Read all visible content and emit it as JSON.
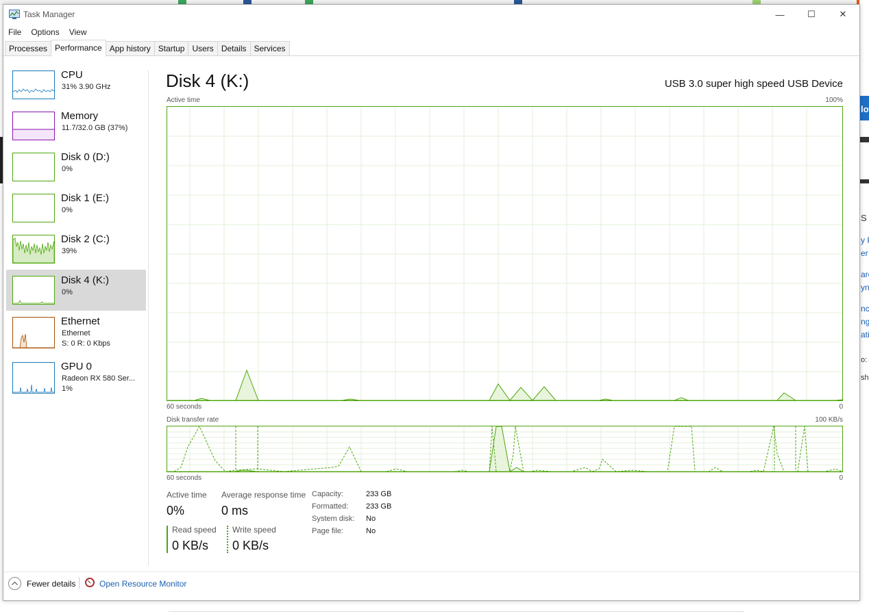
{
  "window": {
    "title": "Task Manager",
    "minimize": "—",
    "maximize": "☐",
    "close": "✕"
  },
  "menu": [
    "File",
    "Options",
    "View"
  ],
  "tabs": [
    "Processes",
    "Performance",
    "App history",
    "Startup",
    "Users",
    "Details",
    "Services"
  ],
  "active_tab": "Performance",
  "sidebar": [
    {
      "name": "CPU",
      "sub": "31%  3.90 GHz",
      "color": "#1779ba"
    },
    {
      "name": "Memory",
      "sub": "11.7/32.0 GB (37%)",
      "color": "#8b12ae"
    },
    {
      "name": "Disk 0 (D:)",
      "sub": "0%",
      "color": "#4da60c"
    },
    {
      "name": "Disk 1 (E:)",
      "sub": "0%",
      "color": "#4da60c"
    },
    {
      "name": "Disk 2 (C:)",
      "sub": "39%",
      "color": "#4da60c"
    },
    {
      "name": "Disk 4 (K:)",
      "sub": "0%",
      "color": "#4da60c"
    },
    {
      "name": "Ethernet",
      "sub": "Ethernet",
      "sub2": "S: 0  R: 0 Kbps",
      "color": "#a74f01"
    },
    {
      "name": "GPU 0",
      "sub": "Radeon RX 580 Ser...",
      "sub2": "1%",
      "color": "#1779ba"
    }
  ],
  "selected_item": "Disk 4 (K:)",
  "main": {
    "title": "Disk 4 (K:)",
    "device": "USB 3.0 super high speed USB Device",
    "graph1": {
      "label": "Active time",
      "max": "100%",
      "time": "60 seconds",
      "min": "0"
    },
    "graph2": {
      "label": "Disk transfer rate",
      "max": "100 KB/s",
      "time": "60 seconds",
      "min": "0"
    }
  },
  "stats": {
    "active_time_label": "Active time",
    "active_time": "0%",
    "avg_response_label": "Average response time",
    "avg_response": "0 ms",
    "read_label": "Read speed",
    "read": "0 KB/s",
    "write_label": "Write speed",
    "write": "0 KB/s"
  },
  "properties": [
    {
      "label": "Capacity:",
      "value": "233 GB"
    },
    {
      "label": "Formatted:",
      "value": "233 GB"
    },
    {
      "label": "System disk:",
      "value": "No"
    },
    {
      "label": "Page file:",
      "value": "No"
    }
  ],
  "footer": {
    "fewer": "Fewer details",
    "resmon": "Open Resource Monitor"
  },
  "colors": {
    "disk": "#4da60c",
    "disk_fill": "#e8f4dc",
    "grid": "#e3efd8",
    "link": "#1a5fb4"
  },
  "background_fragments": [
    "low",
    "S P",
    "y P",
    "er",
    "are",
    "ync",
    "nce",
    "ng,",
    "atio",
    "o: A",
    "she"
  ]
}
